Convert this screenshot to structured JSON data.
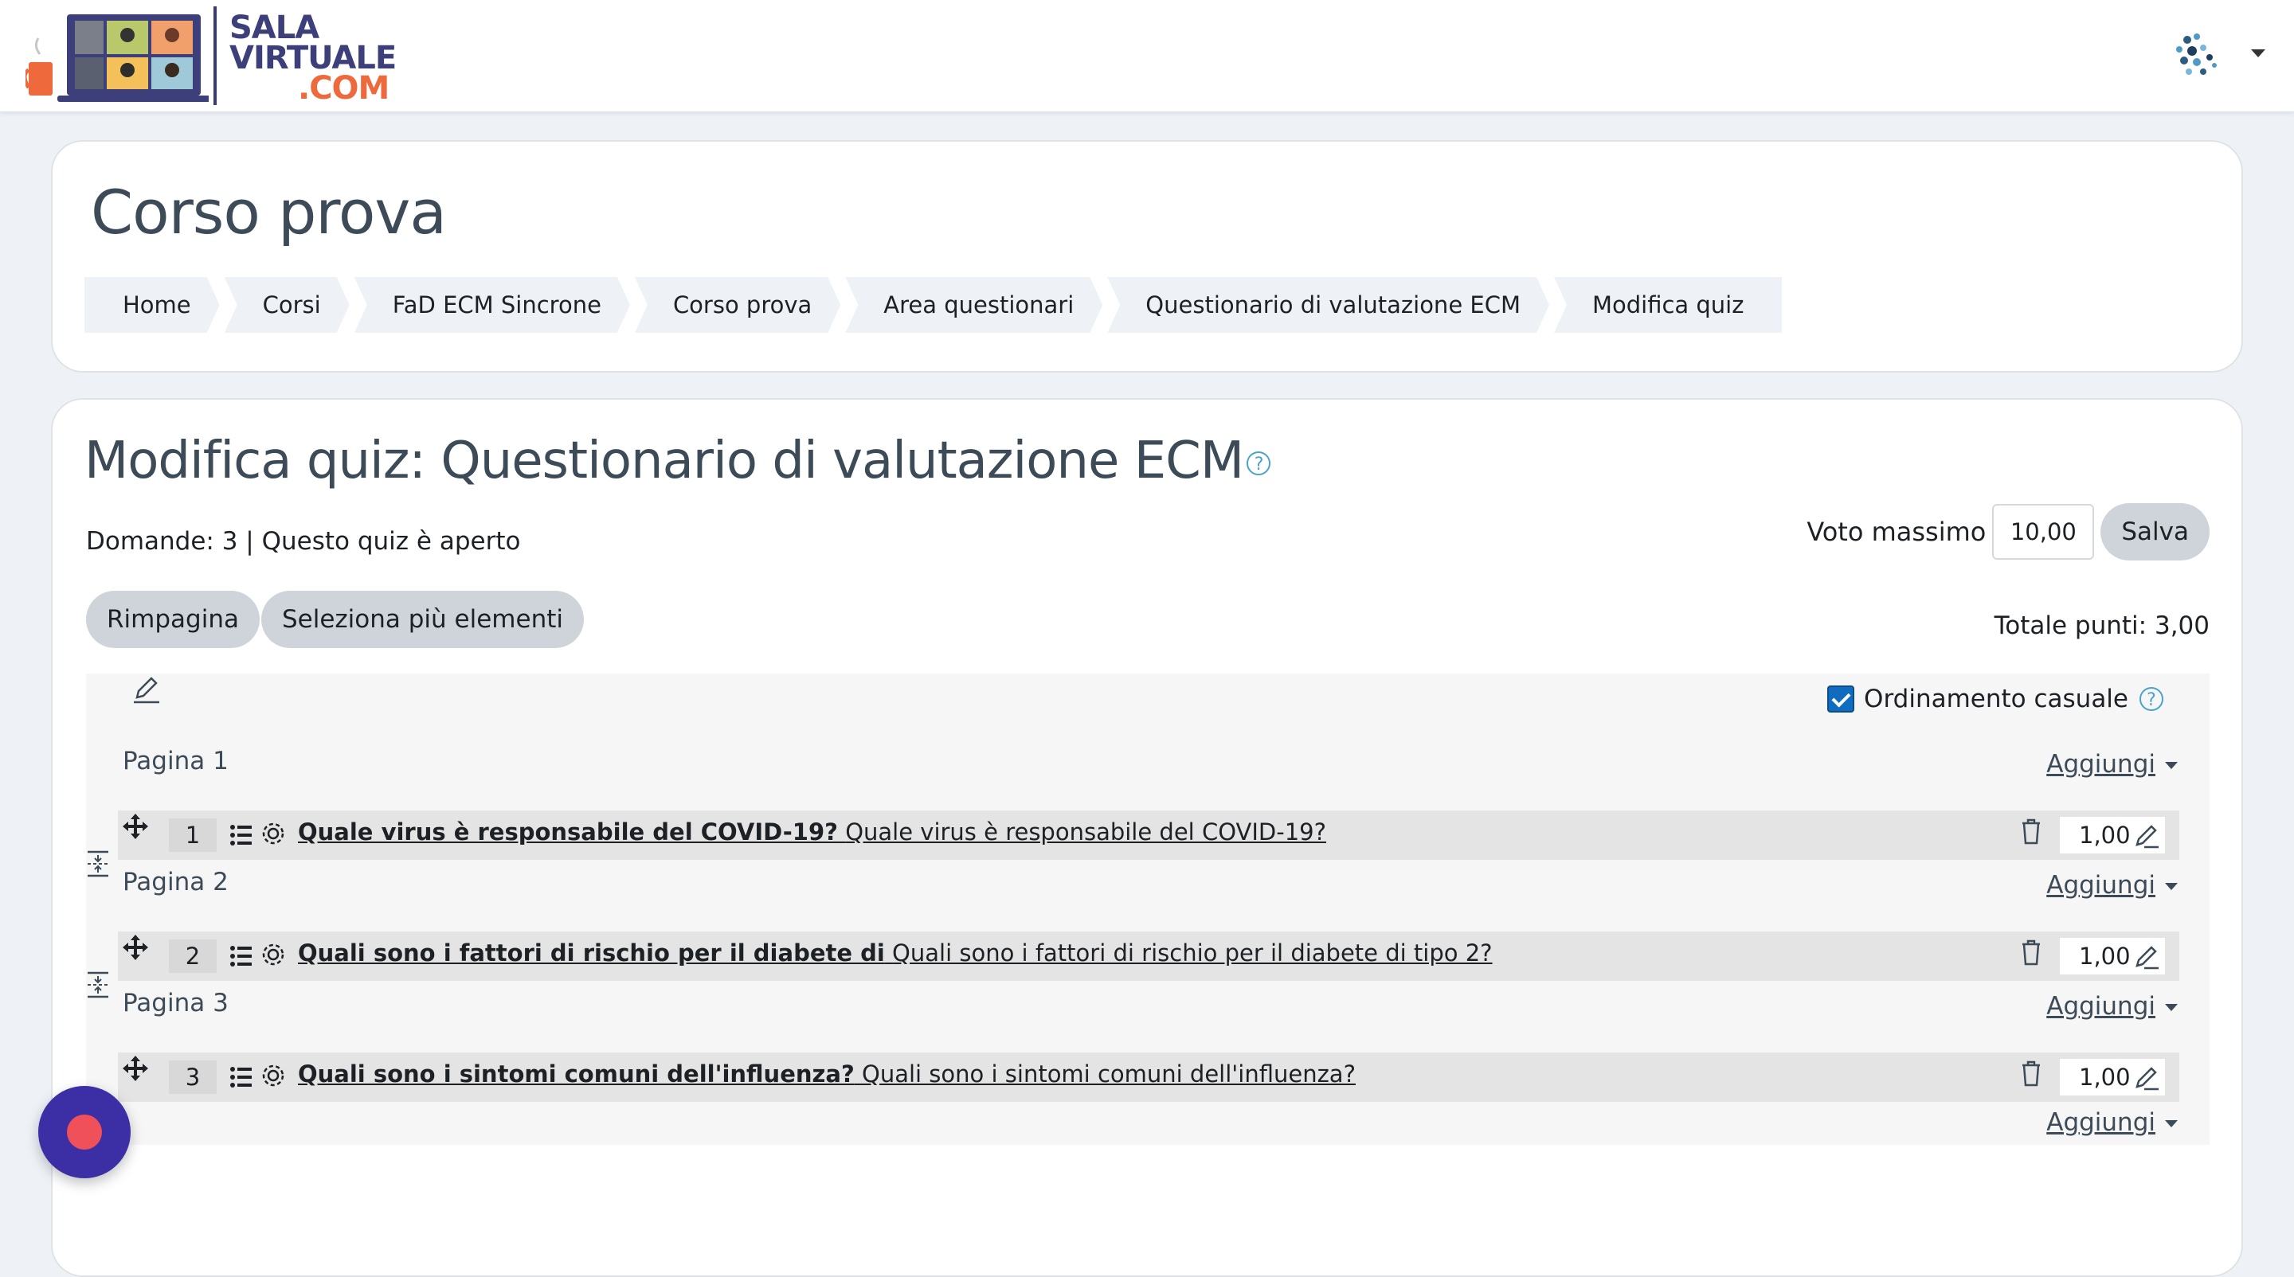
{
  "brand": {
    "line1": "SALA",
    "line2": "VIRTUALE",
    "line3": ".COM",
    "colors": {
      "primary": "#3d3f7a",
      "accent": "#ee6a3c"
    }
  },
  "header": {
    "course_title": "Corso prova",
    "breadcrumb": [
      "Home",
      "Corsi",
      "FaD ECM Sincrone",
      "Corso prova",
      "Area questionari",
      "Questionario di valutazione ECM",
      "Modifica quiz"
    ]
  },
  "main": {
    "heading": "Modifica quiz: Questionario di valutazione ECM",
    "help_icon": "?",
    "stats": "Domande: 3 | Questo quiz è aperto",
    "max_grade_label": "Voto massimo",
    "max_grade_value": "10,00",
    "save_label": "Salva",
    "repaginate_label": "Rimpagina",
    "select_multiple_label": "Seleziona più elementi",
    "total_marks": "Totale punti: 3,00",
    "shuffle_label": "Ordinamento casuale",
    "shuffle_checked": true,
    "add_label": "Aggiungi",
    "pages": [
      {
        "label": "Pagina 1",
        "question": {
          "number": "1",
          "name": "Quale virus è responsabile del COVID-19?",
          "text": "Quale virus è responsabile del COVID-19?",
          "mark": "1,00"
        }
      },
      {
        "label": "Pagina 2",
        "question": {
          "number": "2",
          "name": "Quali sono i fattori di rischio per il diabete di",
          "text": "Quali sono i fattori di rischio per il diabete di tipo 2?",
          "mark": "1,00"
        }
      },
      {
        "label": "Pagina 3",
        "question": {
          "number": "3",
          "name": "Quali sono i sintomi comuni dell'influenza?",
          "text": "Quali sono i sintomi comuni dell'influenza?",
          "mark": "1,00"
        }
      }
    ]
  },
  "icons": {
    "move": "move-icon",
    "list": "list-icon",
    "settings": "gear-icon",
    "delete": "trash-icon",
    "edit": "pencil-icon",
    "page_break": "page-split-icon",
    "record": "record-icon"
  }
}
